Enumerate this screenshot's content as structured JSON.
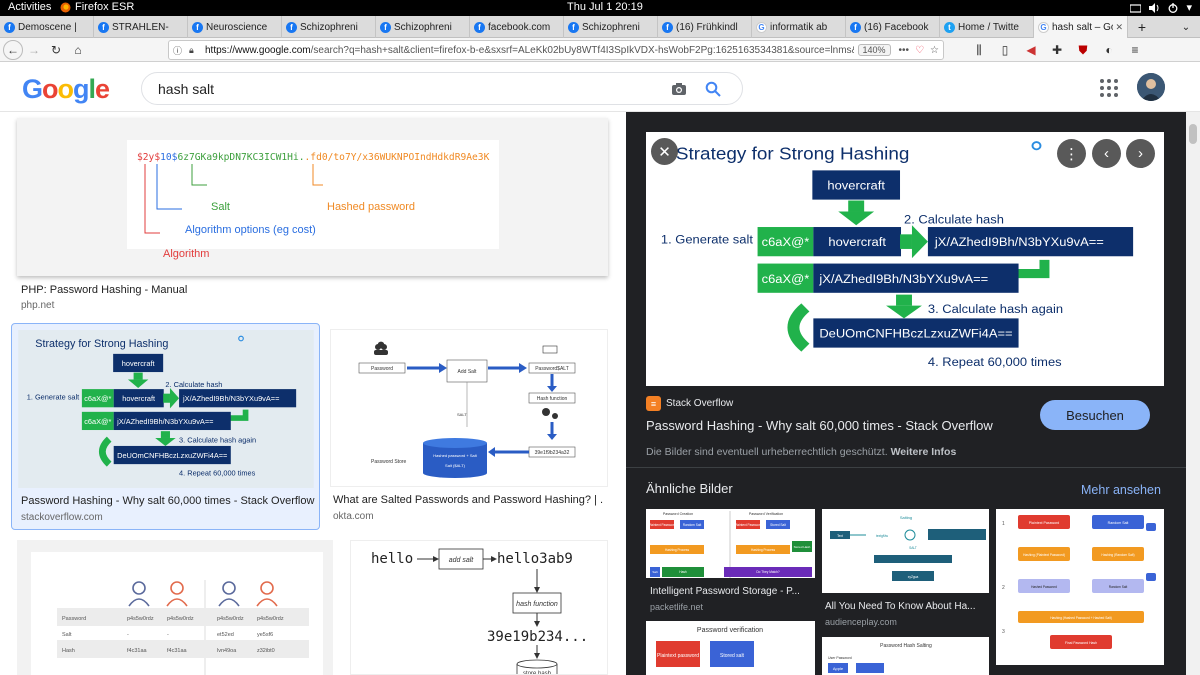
{
  "topbar": {
    "activities": "Activities",
    "app": "Firefox ESR",
    "clock": "Thu Jul 1  20:19"
  },
  "tabs": [
    {
      "title": "Demoscene |",
      "icon": "facebook-icon"
    },
    {
      "title": "STRAHLEN-",
      "icon": "facebook-icon"
    },
    {
      "title": "Neuroscience",
      "icon": "facebook-icon"
    },
    {
      "title": "Schizophreni",
      "icon": "facebook-icon"
    },
    {
      "title": "Schizophreni",
      "icon": "facebook-icon"
    },
    {
      "title": "facebook.com",
      "icon": "facebook-icon"
    },
    {
      "title": "Schizophreni",
      "icon": "facebook-icon"
    },
    {
      "title": "(16) Frühkindl",
      "icon": "facebook-icon"
    },
    {
      "title": "informatik ab",
      "icon": "google-icon"
    },
    {
      "title": "(16) Facebook",
      "icon": "facebook-icon"
    },
    {
      "title": "Home / Twitte",
      "icon": "twitter-icon"
    },
    {
      "title": "hash salt – Go",
      "icon": "google-icon",
      "active": true
    }
  ],
  "nav": {
    "url_host": "https://www.google.com",
    "url_rest": "/search?q=hash+salt&client=firefox-b-e&sxsrf=ALeKk02bUy8WTf4I3SpIkVDX-hsWobF2Pg:1625163534381&source=lnms&tbm=isch&s",
    "zoom": "140%"
  },
  "google": {
    "query": "hash salt"
  },
  "results": [
    {
      "title": "PHP: Password Hashing - Manual",
      "source": "php.net"
    },
    {
      "title": "Password Hashing - Why salt 60,000 times - Stack Overflow",
      "source": "stackoverflow.com"
    },
    {
      "title": "What are Salted Passwords and Password Hashing? | ...",
      "source": "okta.com"
    }
  ],
  "php_thumb": {
    "hash": "$2y$10$6z7GKa9kpDN7KC3ICW1Hi.fd0/to7Y/x36WUKNPOIndHdkdR9Ae3K",
    "salt": "Salt",
    "hashed": "Hashed password",
    "options": "Algorithm options (eg cost)",
    "algorithm": "Algorithm"
  },
  "okta_thumb": {
    "password": "Password",
    "add_salt": "Add Salt",
    "pw_salt": "Password$ALT",
    "hash_fn": "Hash function",
    "salt": "SALT",
    "hashval": "39e1f9b234a32",
    "store": "Password Store",
    "db": "Hashed password + Salt",
    "db2": "Salt ($ALT)"
  },
  "hello_thumb": {
    "hello": "hello",
    "add_salt": "add salt",
    "hello_salted": "hello3ab9",
    "hash_function": "hash function",
    "result": "39e19b234...",
    "store": "store hash"
  },
  "table_thumb": {
    "rows": [
      {
        "label": "Password",
        "cells": [
          "p4s5w0rdz",
          "p4s5w0rdz",
          "p4s5w0rdz",
          "p4s5w0rdz"
        ]
      },
      {
        "label": "Salt",
        "cells": [
          "-",
          "-",
          "et52ed",
          "ye5sf6"
        ]
      },
      {
        "label": "Hash",
        "cells": [
          "f4c31aa",
          "f4c31aa",
          "lvn49oa",
          "z32ibt0"
        ]
      }
    ]
  },
  "diagram": {
    "title": "Strategy for Strong Hashing",
    "hovercraft": "hovercraft",
    "step1": "1. Generate salt",
    "salt": "c6aX@*",
    "step2": "2. Calculate hash",
    "hash": "jX/AZhedI9Bh/N3bYXu9vA==",
    "step3": "3. Calculate hash again",
    "hash2": "DeUOmCNFHBczLzxuZWFi4A==",
    "step4": "4. Repeat 60,000 times"
  },
  "panel": {
    "site": "Stack Overflow",
    "title": "Password Hashing - Why salt 60,000 times - Stack Overflow",
    "visit": "Besuchen",
    "copyright": "Die Bilder sind eventuell urheberrechtlich geschützt.",
    "more_info": "Weitere Infos",
    "related_heading": "Ähnliche Bilder",
    "see_more": "Mehr ansehen",
    "related": [
      {
        "title": "Intelligent Password Storage - P...",
        "source": "packetlife.net"
      },
      {
        "title": "All You Need To Know About Ha...",
        "source": "audienceplay.com"
      },
      {
        "title": "",
        "source": ""
      }
    ],
    "rel1": {
      "creation": "Password Creation",
      "verification": "Password Verification",
      "plaintext": "Plaintext Password",
      "random": "Random Salt",
      "stored": "Stored Salt",
      "hashing": "Hashing Process",
      "salt": "Salt",
      "hash": "Hash",
      "stored_hash": "Stored Hash",
      "match": "Do They Match?"
    },
    "rel2": {
      "salting": "Salting",
      "text": "Text",
      "salt": "SALT",
      "result": "xyZgua"
    },
    "rel3": {
      "plain": "Plaintext Password",
      "random": "Random Salt",
      "hashing": "Hashing (Plaintext Password)",
      "hashing2": "Hashing (Random Salt)",
      "hashed": "Hashed Password",
      "salt": "Random Salt",
      "combined": "Hashing (Hashed Password + Hashed Salt)",
      "final": "Final Password Hash",
      "n1": "1",
      "n2": "2",
      "n3": "3"
    },
    "rel4": {
      "title": "Password verification",
      "plaintext": "Plaintext password",
      "stored": "Stored salt"
    },
    "rel5": {
      "title": "Password Hash Salting",
      "user": "User Password",
      "apple": "Apple"
    }
  }
}
